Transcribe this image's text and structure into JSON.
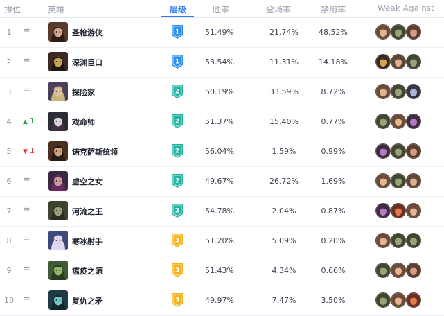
{
  "colors": {
    "tier1": "#2f8ff0",
    "tier2": "#23b3a3",
    "tier3": "#f3b21c",
    "accent": "#2f7cf6",
    "up": "#28a745",
    "down": "#e0343e"
  },
  "header": {
    "rank": "排位",
    "hero": "英雄",
    "tier": "层级",
    "win_rate": "胜率",
    "pick_rate": "登场率",
    "ban_rate": "禁用率",
    "weak_against": "Weak Against"
  },
  "rows": [
    {
      "rank": "1",
      "trend": "=",
      "trend_dir": "same",
      "hero": "圣枪游侠",
      "tier": "1",
      "win": "51.49%",
      "pick": "21.74%",
      "ban": "48.52%",
      "portrait": {
        "bg": "#5b3a2e",
        "skin": "#d7a888",
        "hair": "#2d1d16"
      },
      "weak": [
        {
          "bg": "#6b4a3a",
          "fg": "#e4b58e"
        },
        {
          "bg": "#3f4634",
          "fg": "#9aa377"
        },
        {
          "bg": "#5d3b30",
          "fg": "#d59c84"
        }
      ]
    },
    {
      "rank": "2",
      "trend": "=",
      "trend_dir": "same",
      "hero": "深渊巨口",
      "tier": "1",
      "win": "53.54%",
      "pick": "11.31%",
      "ban": "14.18%",
      "portrait": {
        "bg": "#3b2a24",
        "skin": "#c7a35c",
        "hair": "#1f1612"
      },
      "weak": [
        {
          "bg": "#3a2a24",
          "fg": "#d6a54d"
        },
        {
          "bg": "#5e4436",
          "fg": "#ddb090"
        },
        {
          "bg": "#3f4634",
          "fg": "#9aa377"
        }
      ]
    },
    {
      "rank": "3",
      "trend": "=",
      "trend_dir": "same",
      "hero": "探险家",
      "tier": "2",
      "win": "50.19%",
      "pick": "33.59%",
      "ban": "8.72%",
      "portrait": {
        "bg": "#4b3f5a",
        "skin": "#e2c09f",
        "hair": "#c8b37a"
      },
      "weak": [
        {
          "bg": "#6b4a3a",
          "fg": "#e4b58e"
        },
        {
          "bg": "#3f4634",
          "fg": "#9aa377"
        },
        {
          "bg": "#34364a",
          "fg": "#a8b6d6"
        }
      ]
    },
    {
      "rank": "4",
      "trend": "1",
      "trend_dir": "up",
      "hero": "戏命师",
      "tier": "2",
      "win": "51.37%",
      "pick": "15.40%",
      "ban": "0.77%",
      "portrait": {
        "bg": "#2a2b33",
        "skin": "#d8d6dc",
        "hair": "#412b45"
      },
      "weak": [
        {
          "bg": "#3f4634",
          "fg": "#9aa377"
        },
        {
          "bg": "#6b4a3a",
          "fg": "#e4b58e"
        },
        {
          "bg": "#3d2a44",
          "fg": "#b47bc2"
        }
      ]
    },
    {
      "rank": "5",
      "trend": "1",
      "trend_dir": "down",
      "hero": "诺克萨斯统领",
      "tier": "2",
      "win": "56.04%",
      "pick": "1.59%",
      "ban": "0.99%",
      "portrait": {
        "bg": "#4a3024",
        "skin": "#d3a17e",
        "hair": "#2a1a14"
      },
      "weak": [
        {
          "bg": "#3d2a44",
          "fg": "#b47bc2"
        },
        {
          "bg": "#3f4634",
          "fg": "#9aa377"
        },
        {
          "bg": "#5d3b30",
          "fg": "#d59c84"
        }
      ]
    },
    {
      "rank": "6",
      "trend": "=",
      "trend_dir": "same",
      "hero": "虚空之女",
      "tier": "2",
      "win": "49.67%",
      "pick": "26.72%",
      "ban": "1.69%",
      "portrait": {
        "bg": "#3a2741",
        "skin": "#c99aa0",
        "hair": "#6a2a5e"
      },
      "weak": [
        {
          "bg": "#6b4a3a",
          "fg": "#e4b58e"
        },
        {
          "bg": "#3f4634",
          "fg": "#9aa377"
        },
        {
          "bg": "#5e4436",
          "fg": "#ddb090"
        }
      ]
    },
    {
      "rank": "7",
      "trend": "=",
      "trend_dir": "same",
      "hero": "河流之王",
      "tier": "2",
      "win": "54.78%",
      "pick": "2.04%",
      "ban": "0.87%",
      "portrait": {
        "bg": "#3d4430",
        "skin": "#9aa07a",
        "hair": "#2a2e20"
      },
      "weak": [
        {
          "bg": "#3d2a44",
          "fg": "#b47bc2"
        },
        {
          "bg": "#6a2e24",
          "fg": "#e07a4a"
        },
        {
          "bg": "#6b4a3a",
          "fg": "#e4b58e"
        }
      ]
    },
    {
      "rank": "8",
      "trend": "=",
      "trend_dir": "same",
      "hero": "寒冰射手",
      "tier": "3",
      "win": "51.20%",
      "pick": "5.09%",
      "ban": "0.20%",
      "portrait": {
        "bg": "#3b4a7a",
        "skin": "#e1d2e6",
        "hair": "#dcdcf0"
      },
      "weak": [
        {
          "bg": "#6b4a3a",
          "fg": "#e4b58e"
        },
        {
          "bg": "#3f4634",
          "fg": "#9aa377"
        },
        {
          "bg": "#3f4634",
          "fg": "#9aa377"
        }
      ]
    },
    {
      "rank": "9",
      "trend": "=",
      "trend_dir": "same",
      "hero": "瘟疫之源",
      "tier": "3",
      "win": "51.43%",
      "pick": "4.34%",
      "ban": "0.66%",
      "portrait": {
        "bg": "#3f5a34",
        "skin": "#9ab46a",
        "hair": "#2a3a1e"
      },
      "weak": [
        {
          "bg": "#3f4634",
          "fg": "#9aa377"
        },
        {
          "bg": "#6b4a3a",
          "fg": "#e4b58e"
        },
        {
          "bg": "#5d3b30",
          "fg": "#d59c84"
        }
      ]
    },
    {
      "rank": "10",
      "trend": "=",
      "trend_dir": "same",
      "hero": "复仇之矛",
      "tier": "3",
      "win": "49.97%",
      "pick": "7.47%",
      "ban": "3.50%",
      "portrait": {
        "bg": "#1f3a44",
        "skin": "#6fc4c8",
        "hair": "#12262c"
      },
      "weak": [
        {
          "bg": "#3f4634",
          "fg": "#9aa377"
        },
        {
          "bg": "#6b4a3a",
          "fg": "#e4b58e"
        },
        {
          "bg": "#6a2e24",
          "fg": "#e07a4a"
        }
      ]
    }
  ]
}
